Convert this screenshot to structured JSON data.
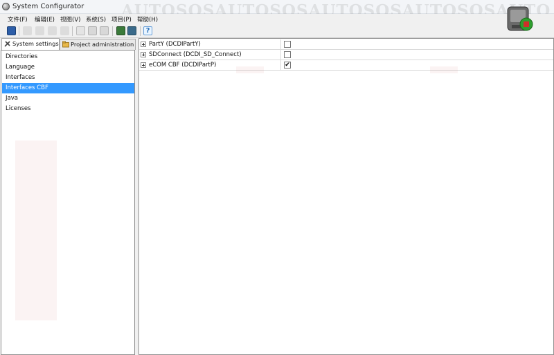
{
  "window": {
    "title": "System Configurator"
  },
  "watermark": "AUTOSOSAUTOSOSAUTOSOSAUTOSOSAUTO",
  "menu": [
    "文件(F)",
    "编辑(E)",
    "视图(V)",
    "系统(S)",
    "项目(P)",
    "帮助(H)"
  ],
  "toolbar": {
    "icons": [
      "save-icon",
      "cut-icon",
      "copy-icon",
      "paste-icon",
      "delete-icon",
      "new-document-icon",
      "save-as-icon",
      "export-icon",
      "book-icon",
      "book-stop-icon",
      "help-icon"
    ]
  },
  "tabs": [
    {
      "label": "System settings",
      "active": true,
      "icon": "tools-icon"
    },
    {
      "label": "Project administration",
      "active": false,
      "icon": "folder-icon"
    }
  ],
  "nav": {
    "items": [
      "Directories",
      "Language",
      "Interfaces",
      "Interfaces CBF",
      "Java",
      "Licenses"
    ],
    "selected_index": 3
  },
  "interfaces": [
    {
      "name": "PartY (DCDIPartY)",
      "checked": false
    },
    {
      "name": "SDConnect (DCDI_SD_Connect)",
      "checked": false
    },
    {
      "name": "eCOM  CBF (DCDIPartP)",
      "checked": true
    }
  ],
  "colors": {
    "selection": "#3399ff",
    "accent_logo": "#2e9e2e"
  },
  "check_glyph": "✔"
}
